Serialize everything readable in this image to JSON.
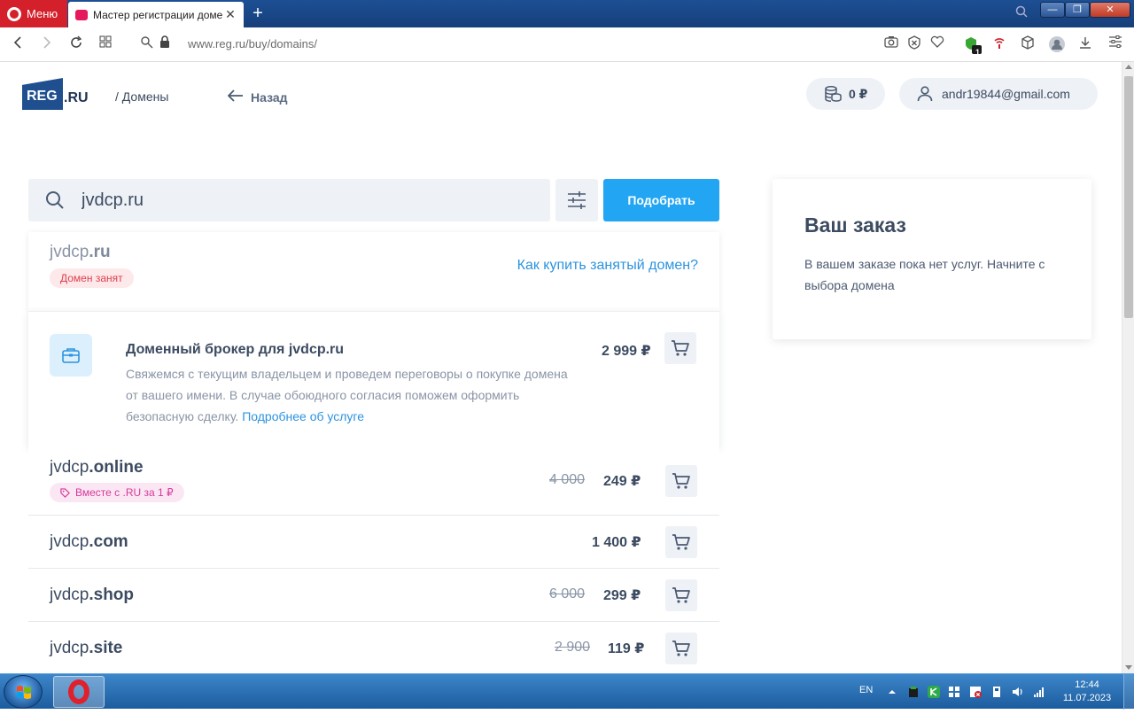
{
  "browser": {
    "menu_label": "Меню",
    "tab_title": "Мастер регистрации доме",
    "tab_close": "✕",
    "new_tab": "+",
    "url": "www.reg.ru/buy/domains/",
    "win_minimize": "—",
    "win_restore": "❐",
    "win_close": "✕",
    "badge_count": "1"
  },
  "header": {
    "logo_box": "REG",
    "logo_ru": ".RU",
    "breadcrumb": "/ Домены",
    "back_label": "Назад",
    "balance": "0 ₽",
    "account_email": "andr19844@gmail.com"
  },
  "search": {
    "query": "jvdcp.ru",
    "button_label": "Подобрать"
  },
  "taken": {
    "base": "jvdcp",
    "tld": ".ru",
    "badge": "Домен занят",
    "link": "Как купить занятый домен?"
  },
  "broker": {
    "title": "Доменный брокер для jvdcp.ru",
    "description": "Свяжемся с текущим владельцем и проведем переговоры о покупке домена от вашего имени. В случае обоюдного согласия поможем оформить безопасную сделку. ",
    "link": "Подробнее об услуге",
    "price": "2 999 ₽"
  },
  "domains": [
    {
      "base": "jvdcp",
      "tld": ".online",
      "old_price": "4 000",
      "price": "249 ₽",
      "promo": "Вместе с .RU за 1 ₽"
    },
    {
      "base": "jvdcp",
      "tld": ".com",
      "old_price": "",
      "price": "1 400 ₽",
      "promo": ""
    },
    {
      "base": "jvdcp",
      "tld": ".shop",
      "old_price": "6 000",
      "price": "299 ₽",
      "promo": ""
    },
    {
      "base": "jvdcp",
      "tld": ".site",
      "old_price": "2 900",
      "price": "119 ₽",
      "promo": ""
    }
  ],
  "order": {
    "title": "Ваш заказ",
    "text": "В вашем заказе пока нет услуг. Начните с выбора домена"
  },
  "taskbar": {
    "lang": "EN",
    "time": "12:44",
    "date": "11.07.2023"
  },
  "colors": {
    "accent": "#22a5f2",
    "link": "#2c93df",
    "text": "#3c4b61",
    "taken_badge": "#e0404f",
    "promo_badge": "#d63a9a"
  }
}
